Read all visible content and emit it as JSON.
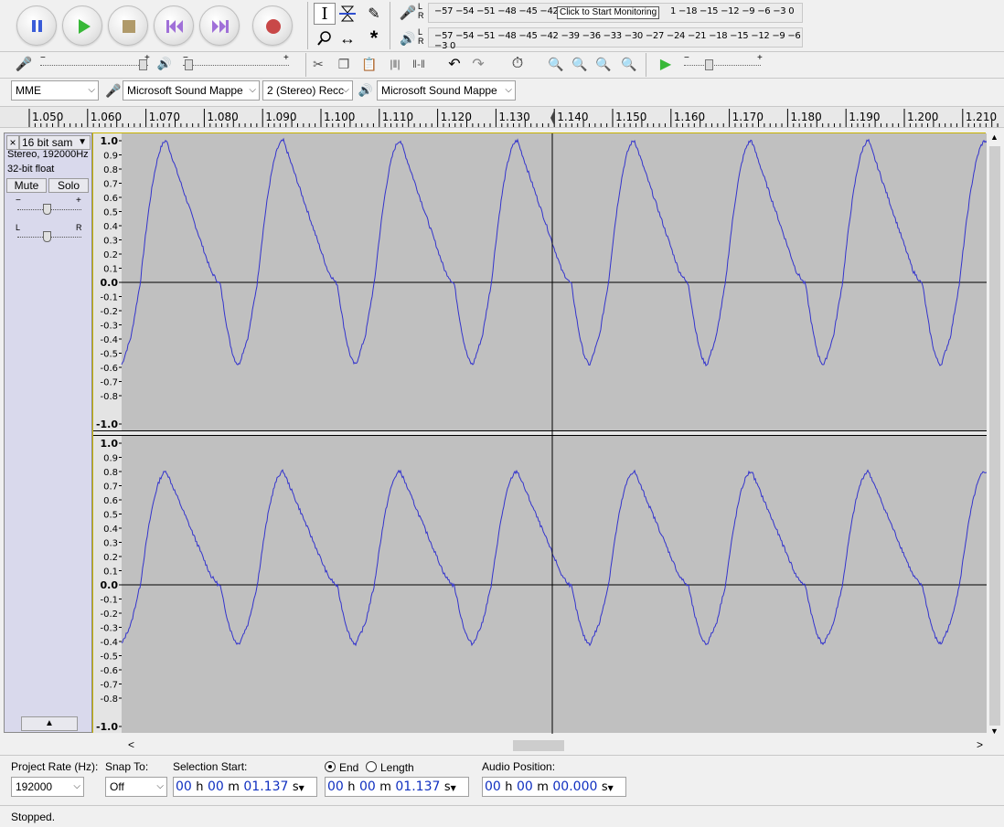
{
  "transport": {
    "pause": "pause-icon",
    "play": "play-icon",
    "stop": "stop-icon",
    "skip_start": "skip-to-start-icon",
    "skip_end": "skip-to-end-icon",
    "record": "record-icon"
  },
  "meters": {
    "record_scale": "−57 −54 −51 −48 −45 −42 −",
    "record_scale_right": "1 −18 −15 −12  −9   −6   −3   0",
    "monitor_tooltip": "Click to Start Monitoring",
    "playback_scale": "−57 −54 −51 −48 −45 −42 −39 −36 −33 −30 −27 −24 −21 −18 −15 −12  −9   −6   −3   0",
    "lr_top": "L",
    "lr_bottom": "R"
  },
  "mixer": {
    "minus": "−",
    "plus": "+"
  },
  "devices": {
    "host": "MME",
    "recording_device": "Microsoft Sound Mappe",
    "channels": "2 (Stereo) Recc",
    "playback_device": "Microsoft Sound Mappe"
  },
  "ruler": {
    "ticks": [
      "1.050",
      "1.060",
      "1.070",
      "1.080",
      "1.090",
      "1.100",
      "1.110",
      "1.120",
      "1.130",
      "1.140",
      "1.150",
      "1.160",
      "1.170",
      "1.180",
      "1.190",
      "1.200",
      "1.210"
    ]
  },
  "track": {
    "name": "16 bit sam",
    "info_line1": "Stereo, 192000Hz",
    "info_line2": "32-bit float",
    "mute": "Mute",
    "solo": "Solo",
    "gain_minus": "−",
    "gain_plus": "+",
    "pan_left": "L",
    "pan_right": "R",
    "close": "×",
    "menu_arrow": "▼",
    "collapse": "▲"
  },
  "waveform": {
    "channel1_scale": [
      "1.0",
      "0.9",
      "0.8",
      "0.7",
      "0.6",
      "0.5",
      "0.4",
      "0.3",
      "0.2",
      "0.1",
      "0.0",
      "-0.1",
      "-0.2",
      "-0.3",
      "-0.4",
      "-0.5",
      "-0.6",
      "-0.7",
      "-0.8",
      "-1.0"
    ],
    "channel2_scale": [
      "1.0",
      "0.9",
      "0.8",
      "0.7",
      "0.6",
      "0.5",
      "0.4",
      "0.3",
      "0.2",
      "0.1",
      "0.0",
      "-0.1",
      "-0.2",
      "-0.3",
      "-0.4",
      "-0.5",
      "-0.6",
      "-0.7",
      "-0.8",
      "-1.0"
    ],
    "color": "#3333cc",
    "background": "#c0c0c0"
  },
  "bottom": {
    "project_rate_label": "Project Rate (Hz):",
    "project_rate": "192000",
    "snap_to_label": "Snap To:",
    "snap_to": "Off",
    "selection_start_label": "Selection Start:",
    "end_label": "End",
    "length_label": "Length",
    "audio_position_label": "Audio Position:",
    "sel_start": {
      "h": "00",
      "m": "00",
      "s": "01.137"
    },
    "sel_end": {
      "h": "00",
      "m": "00",
      "s": "01.137"
    },
    "audio_pos": {
      "h": "00",
      "m": "00",
      "s": "00.000"
    },
    "unit_h": "h",
    "unit_m": "m",
    "unit_s": "s"
  },
  "status": {
    "text": "Stopped."
  },
  "scroll": {
    "left": "<",
    "right": ">",
    "up": "▲",
    "down": "▼"
  }
}
